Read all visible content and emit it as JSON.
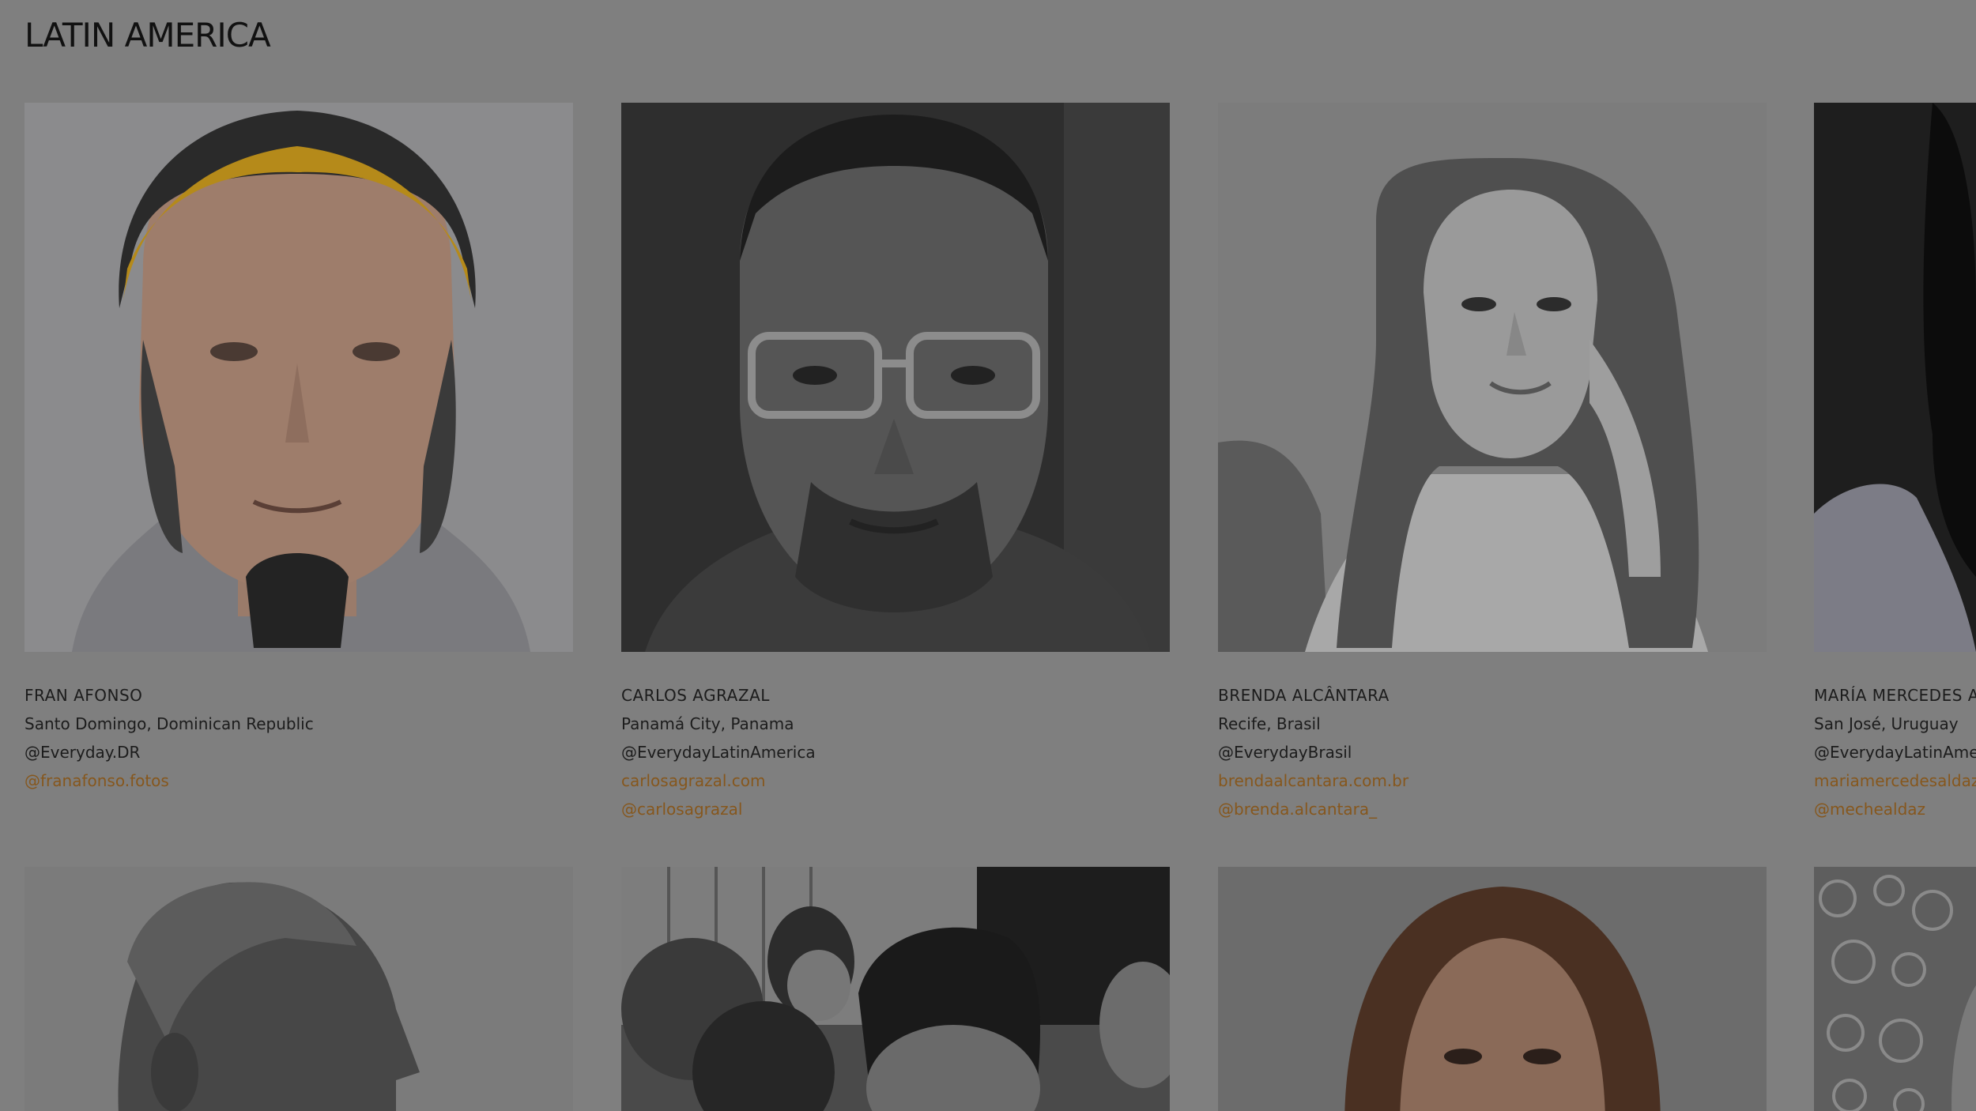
{
  "region": {
    "title": "LATIN AMERICA"
  },
  "colors": {
    "overlay_bg": "#7f7f7f",
    "text": "#1c1c1c",
    "link": "#86571d",
    "headband": "#b58a1a"
  },
  "photographers": [
    {
      "name": "FRAN AFONSO",
      "location": "Santo Domingo, Dominican Republic",
      "feed": "@Everyday.DR",
      "links": [
        "@franafonso.fotos"
      ],
      "photo": "portrait-man-yellow-headband"
    },
    {
      "name": "CARLOS AGRAZAL",
      "location": "Panamá City, Panama",
      "feed": "@EverydayLatinAmerica",
      "links": [
        "carlosagrazal.com",
        "@carlosagrazal"
      ],
      "photo": "portrait-man-glasses"
    },
    {
      "name": "BRENDA ALCÂNTARA",
      "location": "Recife, Brasil",
      "feed": "@EverydayBrasil",
      "links": [
        "brendaalcantara.com.br",
        "@brenda.alcantara_"
      ],
      "photo": "portrait-woman-long-hair"
    },
    {
      "name": "MARÍA MERCEDES A",
      "location": "San José, Uruguay",
      "feed": "@EverydayLatinAme",
      "links": [
        "mariamercedesaldaz.",
        "@mechealdaz"
      ],
      "photo": "portrait-woman-dark"
    }
  ],
  "second_row": [
    {
      "photo": "portrait-man-profile"
    },
    {
      "photo": "photo-group-children"
    },
    {
      "photo": "portrait-woman-smiling"
    },
    {
      "photo": "photo-floral-pattern"
    }
  ]
}
